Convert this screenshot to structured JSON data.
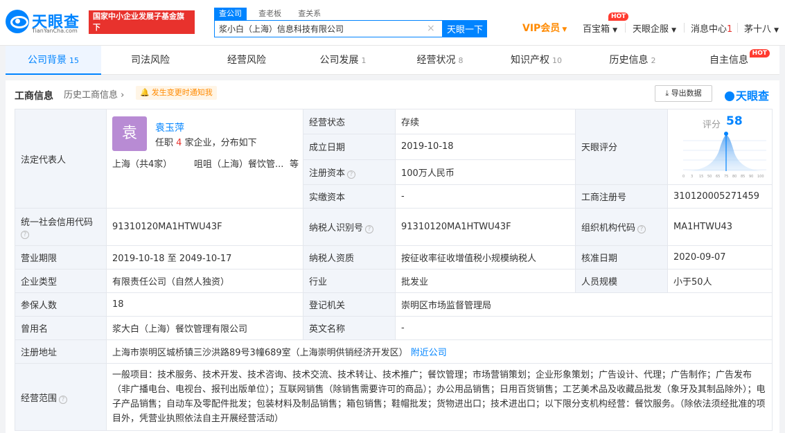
{
  "header": {
    "logo_text": "天眼查",
    "logo_sub": "TianYanCha.com",
    "gov_badge_line1": "国家中小企业发展子基金旗下",
    "gov_badge_line2": "官方备案企业征信机构",
    "search_tabs": [
      "查公司",
      "查老板",
      "查关系"
    ],
    "search_value": "浆小白（上海）信息科技有限公司",
    "search_button": "天眼一下",
    "vip": "VIP会员",
    "baibaoxiang": "百宝箱",
    "hot": "HOT",
    "enterprise": "天眼企服",
    "messages": "消息中心",
    "message_count": "1",
    "user": "茅十八"
  },
  "tabs": [
    {
      "label": "公司背景",
      "count": "15"
    },
    {
      "label": "司法风险",
      "count": ""
    },
    {
      "label": "经营风险",
      "count": ""
    },
    {
      "label": "公司发展",
      "count": "1"
    },
    {
      "label": "经营状况",
      "count": "8"
    },
    {
      "label": "知识产权",
      "count": "10"
    },
    {
      "label": "历史信息",
      "count": "2"
    },
    {
      "label": "自主信息",
      "count": ""
    }
  ],
  "panel": {
    "title": "工商信息",
    "history_link": "历史工商信息",
    "notify": "发生变更时通知我",
    "export": "导出数据",
    "brand": "天眼查"
  },
  "info": {
    "legal_rep_label": "法定代表人",
    "rep_avatar": "袁",
    "rep_name": "袁玉萍",
    "rep_desc_pre": "任职",
    "rep_desc_num": "4",
    "rep_desc_post": "家企业，分布如下",
    "rep_city": "上海（共4家）",
    "rep_company": "咀咀（上海）餐饮管...",
    "rep_more": "等",
    "status_label": "经营状态",
    "status": "存续",
    "founded_label": "成立日期",
    "founded": "2019-10-18",
    "reg_capital_label": "注册资本",
    "reg_capital": "100万人民币",
    "paid_capital_label": "实缴资本",
    "paid_capital": "-",
    "score_label": "天眼评分",
    "score_word": "评分",
    "score": "58",
    "reg_no_label": "工商注册号",
    "reg_no": "310120005271459",
    "credit_code_label": "统一社会信用代码",
    "credit_code": "91310120MA1HTWU43F",
    "taxpayer_id_label": "纳税人识别号",
    "taxpayer_id": "91310120MA1HTWU43F",
    "org_code_label": "组织机构代码",
    "org_code": "MA1HTWU43",
    "term_label": "营业期限",
    "term_start": "2019-10-18",
    "term_mid": "至",
    "term_end": "2049-10-17",
    "taxpayer_qual_label": "纳税人资质",
    "taxpayer_qual": "按征收率征收增值税小规模纳税人",
    "approval_label": "核准日期",
    "approval": "2020-09-07",
    "type_label": "企业类型",
    "type": "有限责任公司（自然人独资）",
    "industry_label": "行业",
    "industry": "批发业",
    "staff_label": "人员规模",
    "staff": "小于50人",
    "insured_label": "参保人数",
    "insured": "18",
    "authority_label": "登记机关",
    "authority": "崇明区市场监督管理局",
    "former_name_label": "曾用名",
    "former_name": "浆大白（上海）餐饮管理有限公司",
    "english_name_label": "英文名称",
    "english_name": "-",
    "address_label": "注册地址",
    "address": "上海市崇明区城桥镇三沙洪路89号3幢689室（上海崇明供销经济开发区）",
    "nearby": "附近公司",
    "scope_label": "经营范围",
    "scope": "一般项目：技术服务、技术开发、技术咨询、技术交流、技术转让、技术推广；餐饮管理；市场营销策划；企业形象策划；广告设计、代理；广告制作；广告发布（非广播电台、电视台、报刊出版单位）；互联网销售（除销售需要许可的商品）；办公用品销售；日用百货销售；工艺美术品及收藏品批发（象牙及其制品除外）；电子产品销售；自动车及零配件批发；包装材料及制品销售；箱包销售；鞋帽批发；货物进出口；技术进出口；以下限分支机构经营：餐饮服务。（除依法须经批准的项目外，凭营业执照依法自主开展经营活动）"
  },
  "colors": {
    "brand": "#0084ff",
    "badge": "#e8322d",
    "vip": "#ff8a00"
  }
}
